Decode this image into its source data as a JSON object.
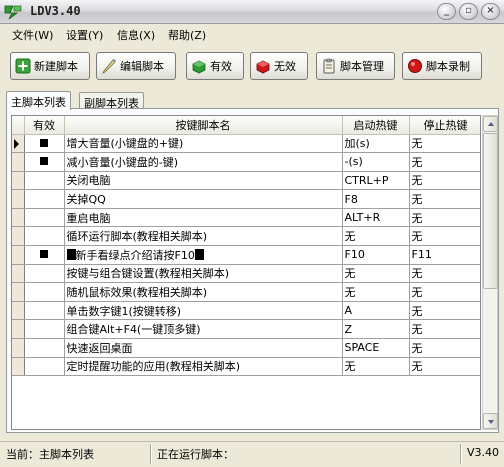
{
  "window": {
    "title": "LDV3.40"
  },
  "window_controls": {
    "minimize": "_",
    "restore": "▫",
    "close": "×"
  },
  "menu": [
    {
      "label": "文件(W)"
    },
    {
      "label": "设置(Y)"
    },
    {
      "label": "信息(X)"
    },
    {
      "label": "帮助(Z)"
    }
  ],
  "toolbar": {
    "new_script": "新建脚本",
    "edit_script": "编辑脚本",
    "enable": "有效",
    "disable": "无效",
    "script_manage": "脚本管理",
    "script_record": "脚本录制"
  },
  "tabs": [
    {
      "label": "主脚本列表",
      "active": true
    },
    {
      "label": "副脚本列表",
      "active": false
    }
  ],
  "table": {
    "columns": [
      "有效",
      "按键脚本名",
      "启动热键",
      "停止热键"
    ],
    "rows": [
      {
        "current": true,
        "enabled": true,
        "name": "增大音量(小键盘的+键)",
        "start_hotkey": "加(s)",
        "stop_hotkey": "无"
      },
      {
        "current": false,
        "enabled": true,
        "name": "减小音量(小键盘的-键)",
        "start_hotkey": "-(s)",
        "stop_hotkey": "无"
      },
      {
        "current": false,
        "enabled": false,
        "name": "关闭电脑",
        "start_hotkey": "CTRL+P",
        "stop_hotkey": "无"
      },
      {
        "current": false,
        "enabled": false,
        "name": "关掉QQ",
        "start_hotkey": "F8",
        "stop_hotkey": "无"
      },
      {
        "current": false,
        "enabled": false,
        "name": "重启电脑",
        "start_hotkey": "ALT+R",
        "stop_hotkey": "无"
      },
      {
        "current": false,
        "enabled": false,
        "name": "循环运行脚本(教程相关脚本)",
        "start_hotkey": "无",
        "stop_hotkey": "无"
      },
      {
        "current": false,
        "enabled": true,
        "name": "新手看绿点介绍请按F10",
        "highlight_blocks": true,
        "start_hotkey": "F10",
        "stop_hotkey": "F11"
      },
      {
        "current": false,
        "enabled": false,
        "name": "按键与组合键设置(教程相关脚本)",
        "start_hotkey": "无",
        "stop_hotkey": "无"
      },
      {
        "current": false,
        "enabled": false,
        "name": "随机鼠标效果(教程相关脚本)",
        "start_hotkey": "无",
        "stop_hotkey": "无"
      },
      {
        "current": false,
        "enabled": false,
        "name": "单击数字键1(按键转移)",
        "start_hotkey": "A",
        "stop_hotkey": "无"
      },
      {
        "current": false,
        "enabled": false,
        "name": "组合键Alt+F4(一键顶多键)",
        "start_hotkey": "Z",
        "stop_hotkey": "无"
      },
      {
        "current": false,
        "enabled": false,
        "name": "快速返回桌面",
        "start_hotkey": "SPACE",
        "stop_hotkey": "无"
      },
      {
        "current": false,
        "enabled": false,
        "name": "定时提醒功能的应用(教程相关脚本)",
        "start_hotkey": "无",
        "stop_hotkey": "无"
      }
    ]
  },
  "status": {
    "current": "当前：主脚本列表",
    "running": "正在运行脚本：",
    "version": "V3.40"
  },
  "colors": {
    "menu_bg": "#ece9d8",
    "icon_green": "#2e9a2e",
    "icon_red": "#d01818"
  }
}
